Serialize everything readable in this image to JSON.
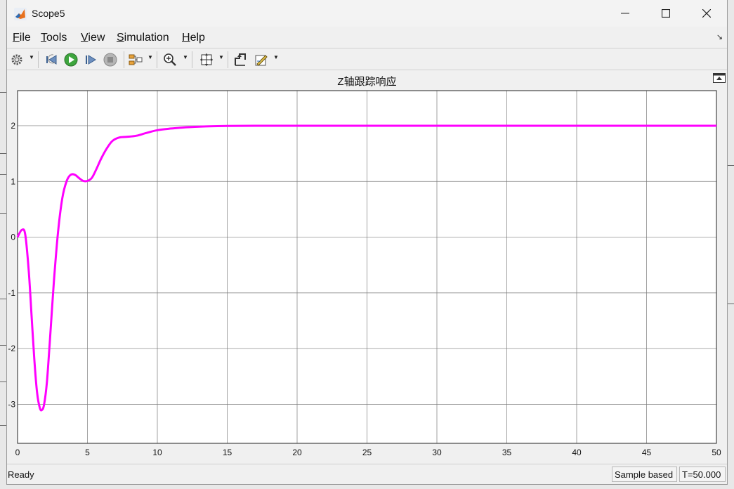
{
  "window": {
    "title": "Scope5"
  },
  "menu": {
    "items": [
      {
        "label": "File",
        "ul": "F",
        "rest": "ile"
      },
      {
        "label": "Tools",
        "ul": "T",
        "rest": "ools"
      },
      {
        "label": "View",
        "ul": "V",
        "rest": "iew"
      },
      {
        "label": "Simulation",
        "ul": "S",
        "rest": "imulation"
      },
      {
        "label": "Help",
        "ul": "H",
        "rest": "elp"
      }
    ]
  },
  "toolbar": {
    "icons": [
      "gear-icon",
      "step-back-icon",
      "run-icon",
      "step-forward-icon",
      "stop-icon",
      "signal-selector-icon",
      "zoom-in-icon",
      "fit-view-icon",
      "cursor-measure-icon",
      "edit-properties-icon"
    ]
  },
  "status": {
    "text": "Ready",
    "mode": "Sample based",
    "time": "T=50.000"
  },
  "colors": {
    "series": "#ff00ff",
    "plot_bg": "#ffffff",
    "grid": "#7a7a7a"
  },
  "chart_data": {
    "type": "line",
    "title": "Z轴跟踪响应",
    "xlabel": "",
    "ylabel": "",
    "xlim": [
      0,
      50
    ],
    "ylim": [
      -3.7,
      2.63
    ],
    "xticks": [
      0,
      5,
      10,
      15,
      20,
      25,
      30,
      35,
      40,
      45,
      50
    ],
    "yticks": [
      -3,
      -2,
      -1,
      0,
      1,
      2
    ],
    "grid": true,
    "series": [
      {
        "color": "#ff00ff",
        "x": [
          0,
          0.3,
          0.55,
          0.8,
          1.0,
          1.2,
          1.4,
          1.6,
          1.75,
          1.9,
          2.1,
          2.3,
          2.6,
          2.9,
          3.2,
          3.5,
          3.8,
          4.1,
          4.4,
          4.7,
          5.0,
          5.3,
          5.6,
          6.0,
          6.4,
          6.8,
          7.3,
          7.8,
          8.5,
          9.2,
          10.0,
          11.0,
          12.0,
          13.0,
          14.0,
          15.0,
          17.0,
          20.0,
          25.0,
          30.0,
          35.0,
          40.0,
          45.0,
          50.0
        ],
        "y": [
          0.0,
          0.13,
          0.05,
          -0.6,
          -1.4,
          -2.2,
          -2.8,
          -3.07,
          -3.1,
          -3.0,
          -2.6,
          -1.9,
          -0.8,
          0.1,
          0.7,
          1.0,
          1.12,
          1.12,
          1.06,
          1.01,
          1.01,
          1.06,
          1.2,
          1.42,
          1.6,
          1.73,
          1.79,
          1.8,
          1.82,
          1.87,
          1.92,
          1.95,
          1.97,
          1.985,
          1.992,
          1.996,
          1.999,
          2.0,
          2.0,
          2.0,
          2.0,
          2.0,
          2.0,
          2.0
        ]
      }
    ]
  }
}
